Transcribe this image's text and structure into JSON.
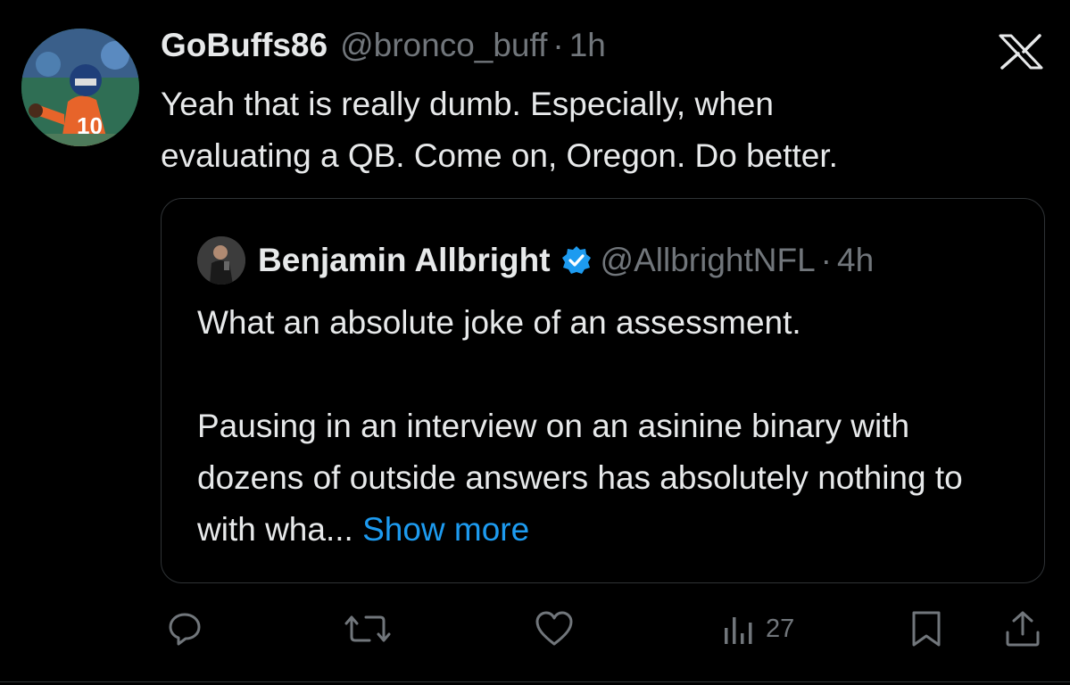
{
  "post": {
    "avatar_icon": "user-avatar-football-player",
    "display_name": "GoBuffs86",
    "handle": "@bronco_buff",
    "separator": "·",
    "time": "1h",
    "close_icon": "x-logo-icon",
    "text": "Yeah that is really dumb. Especially, when\nevaluating a QB. Come on, Oregon. Do better."
  },
  "quoted_post": {
    "avatar_icon": "user-avatar-photo",
    "display_name": "Benjamin Allbright",
    "verified_icon": "verified-badge-icon",
    "handle": "@AllbrightNFL",
    "separator": "·",
    "time": "4h",
    "paragraph_1": "What an absolute joke of an assessment.",
    "paragraph_2": "Pausing in an interview on an asinine binary with dozens of outside answers has absolutely nothing to with wha...",
    "show_more": "Show more"
  },
  "actions": {
    "reply_icon": "reply-icon",
    "repost_icon": "repost-icon",
    "like_icon": "heart-icon",
    "views_icon": "views-chart-icon",
    "views_count": "27",
    "bookmark_icon": "bookmark-icon",
    "share_icon": "share-icon"
  },
  "colors": {
    "background": "#000000",
    "primary_text": "#e7e9ea",
    "secondary_text": "#71767b",
    "link": "#1d9bf0",
    "border": "#2f3336"
  }
}
